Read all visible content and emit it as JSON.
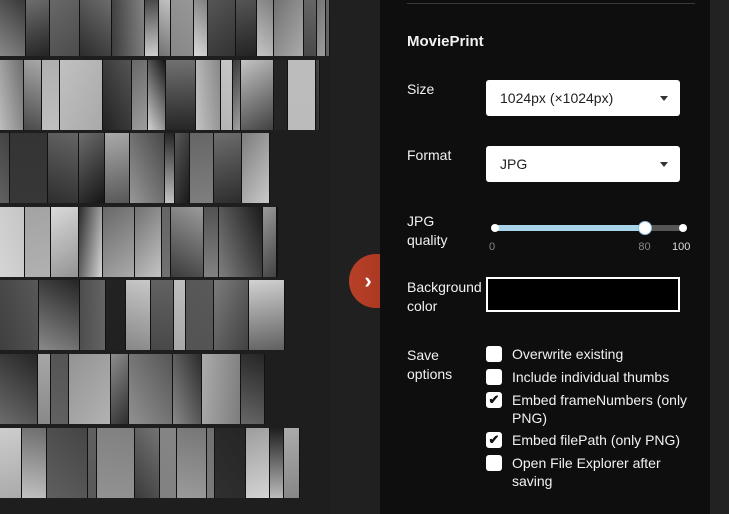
{
  "panel": {
    "title": "MoviePrint",
    "size": {
      "label": "Size",
      "value": "1024px (×1024px)"
    },
    "format": {
      "label": "Format",
      "value": "JPG"
    },
    "quality": {
      "label": "JPG quality",
      "min": 0,
      "max": 100,
      "value": 80,
      "min_label": "0",
      "value_label": "80",
      "max_label": "100"
    },
    "background": {
      "label": "Background color",
      "color": "#000000"
    },
    "save_options": {
      "label": "Save options",
      "items": [
        {
          "label": "Overwrite existing",
          "checked": false
        },
        {
          "label": "Include individual thumbs",
          "checked": false
        },
        {
          "label": "Embed frameNumbers (only PNG)",
          "checked": true
        },
        {
          "label": "Embed filePath (only PNG)",
          "checked": true
        },
        {
          "label": "Open File Explorer after saving",
          "checked": false
        }
      ]
    }
  },
  "toggle_icon": "chevron-right-icon",
  "colors": {
    "accent": "#a7d4e8",
    "toggle": "#a6361f",
    "panel_bg": "#0e0e0e"
  }
}
